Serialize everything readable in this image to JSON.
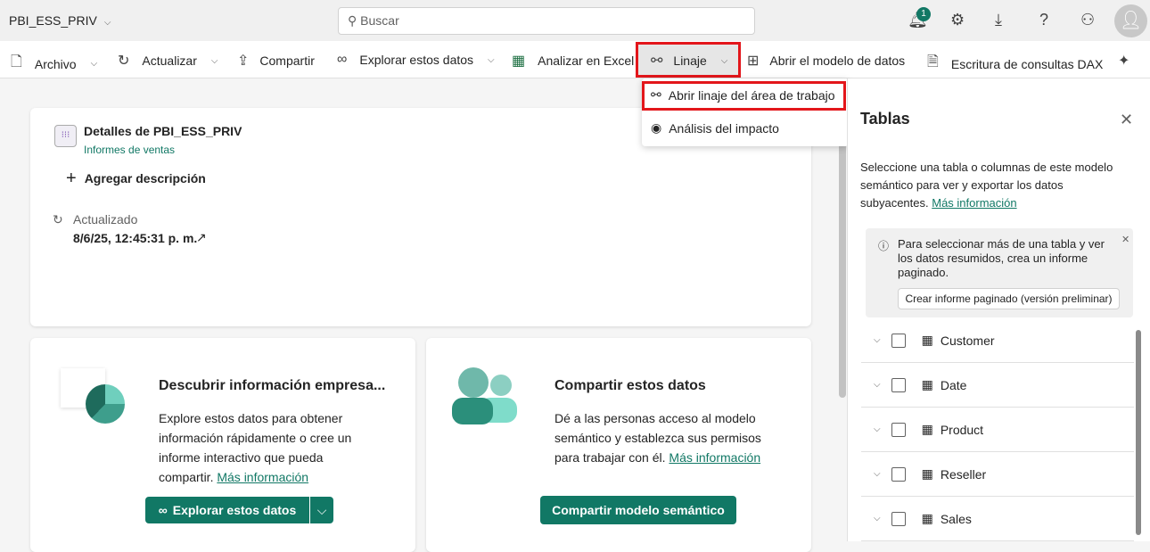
{
  "header": {
    "workspace": "PBI_ESS_PRIV",
    "search_placeholder": "Buscar",
    "notification_count": "1"
  },
  "toolbar": {
    "archivo": "Archivo",
    "actualizar": "Actualizar",
    "compartir": "Compartir",
    "explorar": "Explorar estos datos",
    "excel": "Analizar en Excel",
    "linaje": "Linaje",
    "modelo": "Abrir el modelo de datos",
    "dax": "Escritura de consultas DAX"
  },
  "linaje_menu": {
    "items": [
      "Abrir linaje del área de trabajo",
      "Análisis del impacto"
    ]
  },
  "details": {
    "title": "Detalles de PBI_ESS_PRIV",
    "subtitle": "Informes de ventas",
    "add_description": "Agregar descripción",
    "updated_label": "Actualizado",
    "updated_value": "8/6/25, 12:45:31 p. m."
  },
  "discover": {
    "title": "Descubrir información empresa...",
    "body": "Explore estos datos para obtener información rápidamente o cree un informe interactivo que pueda compartir.",
    "link": "Más información",
    "button": "Explorar estos datos"
  },
  "share": {
    "title": "Compartir estos datos",
    "body": "Dé a las personas acceso al modelo semántico y establezca sus permisos para trabajar con él.",
    "link": "Más información",
    "button": "Compartir modelo semántico"
  },
  "panel": {
    "title": "Tablas",
    "description": "Seleccione una tabla o columnas de este modelo semántico para ver y exportar los datos subyacentes.",
    "link": "Más información",
    "info": "Para seleccionar más de una tabla y ver los datos resumidos, crea un informe paginado.",
    "info_button": "Crear informe paginado (versión preliminar)",
    "tables": [
      "Customer",
      "Date",
      "Product",
      "Reseller",
      "Sales"
    ]
  },
  "colors": {
    "accent": "#117865",
    "highlight": "#e3161b"
  }
}
